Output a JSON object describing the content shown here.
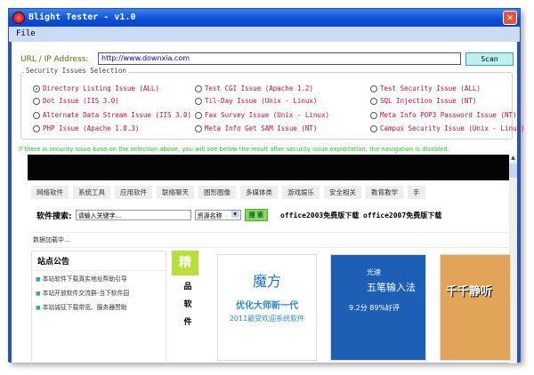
{
  "window": {
    "title": "Blight Tester - v1.0",
    "menu": [
      "File"
    ]
  },
  "url": {
    "label": "URL / IP Address:",
    "value": "http://www.downxia.com",
    "scan_label": "Scan"
  },
  "group": {
    "label": "Security Issues Selection",
    "options": [
      {
        "label": "Directory Listing Issue (ALL)",
        "selected": true
      },
      {
        "label": "Dot Issue (IIS 3.0)",
        "selected": false
      },
      {
        "label": "Alternate Data Stream Issue (IIS 3.0)",
        "selected": false
      },
      {
        "label": "PHP Issue (Apache 1.0.3)",
        "selected": false
      },
      {
        "label": "Test CGI Issue (Apache 1.2)",
        "selected": false
      },
      {
        "label": "Til-Day Issue (Unix - Linux)",
        "selected": false
      },
      {
        "label": "Fax Survey Issue (Unix - Linux)",
        "selected": false
      },
      {
        "label": "Meta Info Get SAM Issue (NT)",
        "selected": false
      },
      {
        "label": "Test Security Issue (ALL)",
        "selected": false
      },
      {
        "label": "SQL Injection Issue (NT)",
        "selected": false
      },
      {
        "label": "Meta Info POP3 Password Issue (NT)",
        "selected": false
      },
      {
        "label": "Campus Security Issue (Unix - Linux)",
        "selected": false
      }
    ]
  },
  "note": "If there is security issue base on the selection above, you will see below the result after security issue exploitation, the navigation is disabled.",
  "site": {
    "nav": [
      "网络软件",
      "系统工具",
      "应用软件",
      "联络聊天",
      "图形图像",
      "多媒体类",
      "游戏娱乐",
      "安全相关",
      "教育教学",
      "手"
    ],
    "search_label": "软件搜索:",
    "search_placeholder": "请输入关键字...",
    "search_select": "资源名称",
    "search_button": "搜 索",
    "hot_links": "office2003免费版下载 office2007免费版下载",
    "loading": "数据加载中...",
    "notice_title": "站点公告",
    "notices": [
      "本站软件下载真实地址帮助引导",
      "本站开放软件交流群-当下软件园",
      "本站诚征下载带宽、服务器赞助"
    ],
    "jing": [
      "精",
      "品",
      "软",
      "件"
    ],
    "cards": [
      {
        "title": "魔方",
        "sub": "优化大师新一代",
        "sub2": "2011最受欢迎系统软件"
      },
      {
        "title": "光速",
        "sub": "五笔输入法",
        "sub2": "9.2分  89%好评"
      },
      {
        "title": "千千静听"
      }
    ]
  }
}
